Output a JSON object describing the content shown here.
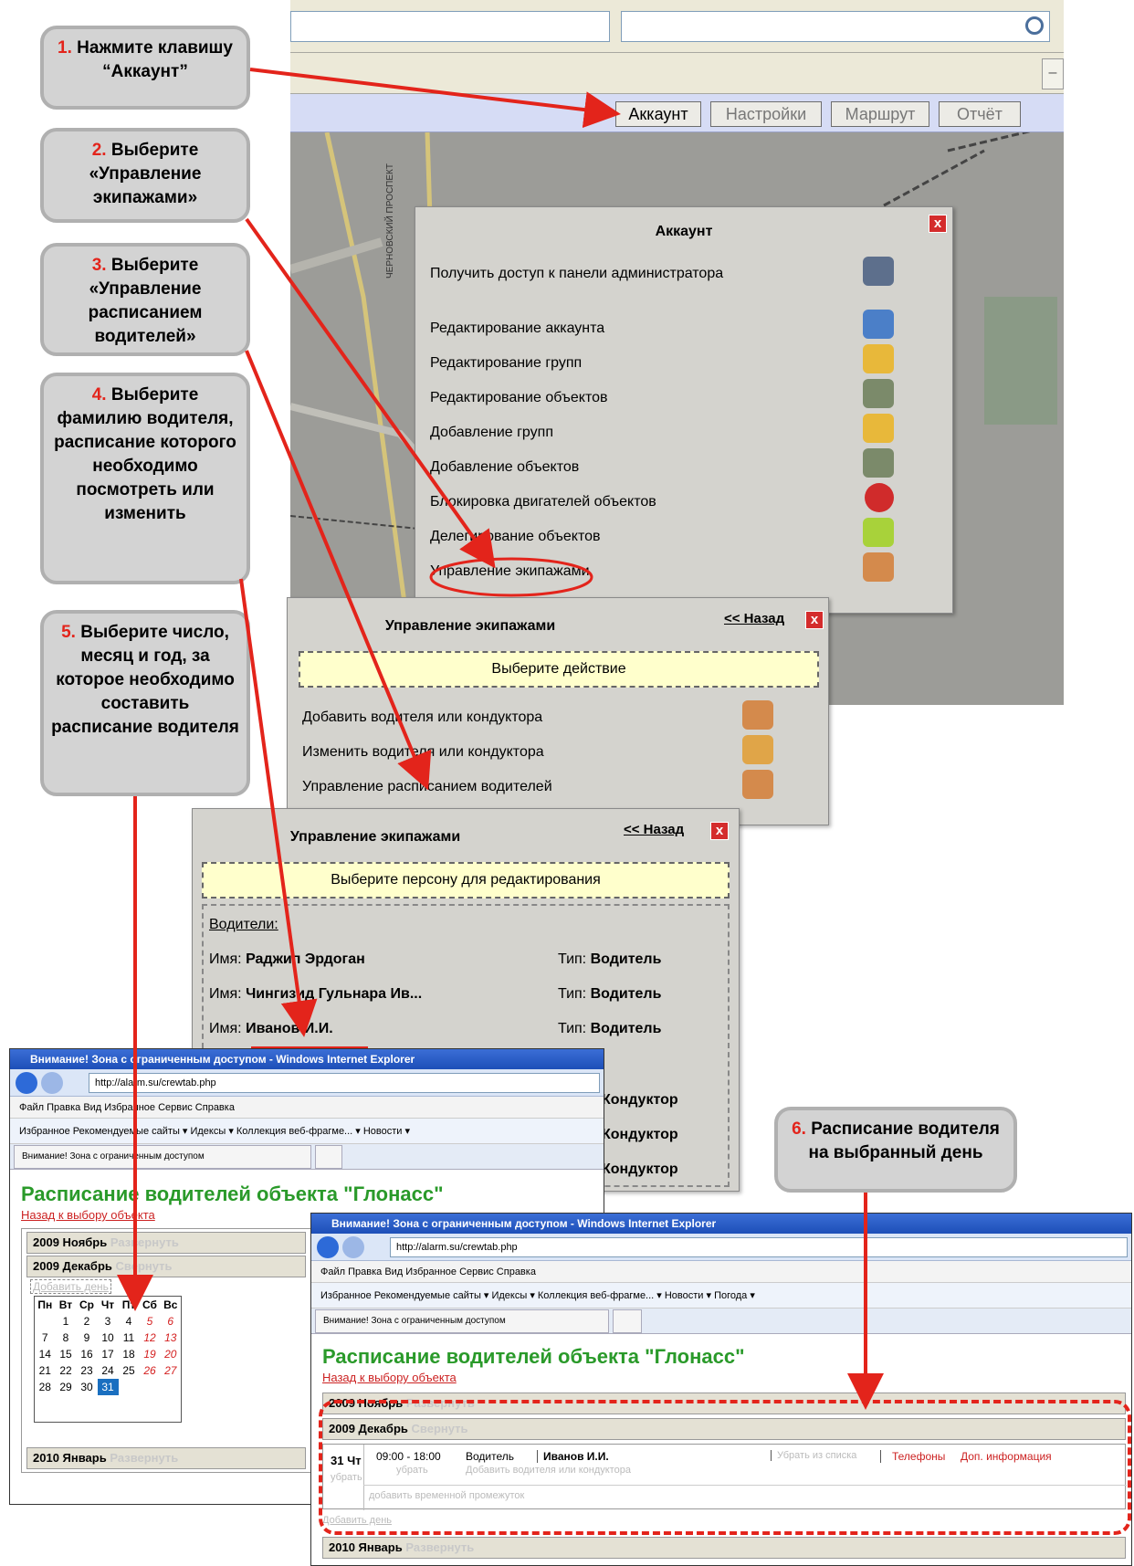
{
  "top": {
    "menu": [
      "Аккаунт",
      "Настройки",
      "Маршрут",
      "Отчёт"
    ],
    "street": "ЧЕРНОВСКИЙ ПРОСПЕКТ"
  },
  "account": {
    "title": "Аккаунт",
    "items": [
      "Получить доступ к панели администратора",
      "Редактирование аккаунта",
      "Редактирование групп",
      "Редактирование объектов",
      "Добавление групп",
      "Добавление объектов",
      "Блокировка двигателей объектов",
      "Делегирование объектов",
      "Управление экипажами"
    ],
    "close": "x"
  },
  "crew1": {
    "title": "Управление экипажами",
    "back": "<< Назад",
    "prompt": "Выберите действие",
    "items": [
      "Добавить водителя или кондуктора",
      "Изменить водителя или кондуктора",
      "Управление расписанием водителей"
    ]
  },
  "crew2": {
    "title": "Управление экипажами",
    "back": "<< Назад",
    "prompt": "Выберите персону для редактирования",
    "section": "Водители:",
    "name_label": "Имя:",
    "type_label": "Тип:",
    "people": [
      {
        "name": "Раджип Эрдоган",
        "type": "Водитель"
      },
      {
        "name": "Чингизид Гульнара Ив...",
        "type": "Водитель"
      },
      {
        "name": "Иванов И.И.",
        "type": "Водитель"
      }
    ],
    "conductors": [
      "Кондуктор",
      "Кондуктор",
      "Кондуктор"
    ]
  },
  "callouts": [
    {
      "num": "1.",
      "text": "Нажмите клавишу “Аккаунт”"
    },
    {
      "num": "2.",
      "text": "Выберите «Управление экипажами»"
    },
    {
      "num": "3.",
      "text": "Выберите «Управление расписанием водителей»"
    },
    {
      "num": "4.",
      "text": "Выберите фамилию водителя, расписание которого необходимо посмотреть или изменить"
    },
    {
      "num": "5.",
      "text": "Выберите число, месяц и год, за которое необходимо составить расписание водителя"
    },
    {
      "num": "6.",
      "text": "Расписание водителя на выбранный день"
    }
  ],
  "ie": {
    "title": "Внимание! Зона с ограниченным доступом - Windows Internet Explorer",
    "url": "http://alarm.su/crewtab.php",
    "menu": "Файл   Правка   Вид   Избранное   Сервис   Справка",
    "fav1": "Избранное   Рекомендуемые сайты ▾   Идексы ▾   Коллекция веб-фрагме...  ▾   Новости ▾",
    "fav2": "Избранное   Рекомендуемые сайты ▾   Идексы ▾   Коллекция веб-фрагме...  ▾   Новости ▾   Погода ▾",
    "tab": "Внимание! Зона с ограниченным доступом",
    "heading": "Расписание водителей объекта \"Глонасс\"",
    "backlink": "Назад к выбору объекта"
  },
  "months": {
    "nov": "2009 Ноябрь",
    "dec": "2009 Декабрь",
    "jan": "2010 Январь",
    "expand": "Развернуть",
    "collapse": "Свернуть",
    "addday": "Добавить день"
  },
  "calendar": {
    "head": [
      "Пн",
      "Вт",
      "Ср",
      "Чт",
      "Пт",
      "Сб",
      "Вс"
    ],
    "rows": [
      [
        "",
        "1",
        "2",
        "3",
        "4",
        "5",
        "6"
      ],
      [
        "7",
        "8",
        "9",
        "10",
        "11",
        "12",
        "13"
      ],
      [
        "14",
        "15",
        "16",
        "17",
        "18",
        "19",
        "20"
      ],
      [
        "21",
        "22",
        "23",
        "24",
        "25",
        "26",
        "27"
      ],
      [
        "28",
        "29",
        "30",
        "31",
        "",
        "",
        ""
      ]
    ]
  },
  "schedule": {
    "day": "31 Чт",
    "remove_day": "убрать",
    "time": "09:00 - 18:00",
    "remove": "убрать",
    "role": "Водитель",
    "person": "Иванов И.И.",
    "add_person": "Добавить водителя или кондуктора",
    "remove_list": "Убрать из списка",
    "phones": "Телефоны",
    "info": "Доп. информация",
    "add_interval": "добавить временной промежуток",
    "add_day": "Добавить день"
  }
}
